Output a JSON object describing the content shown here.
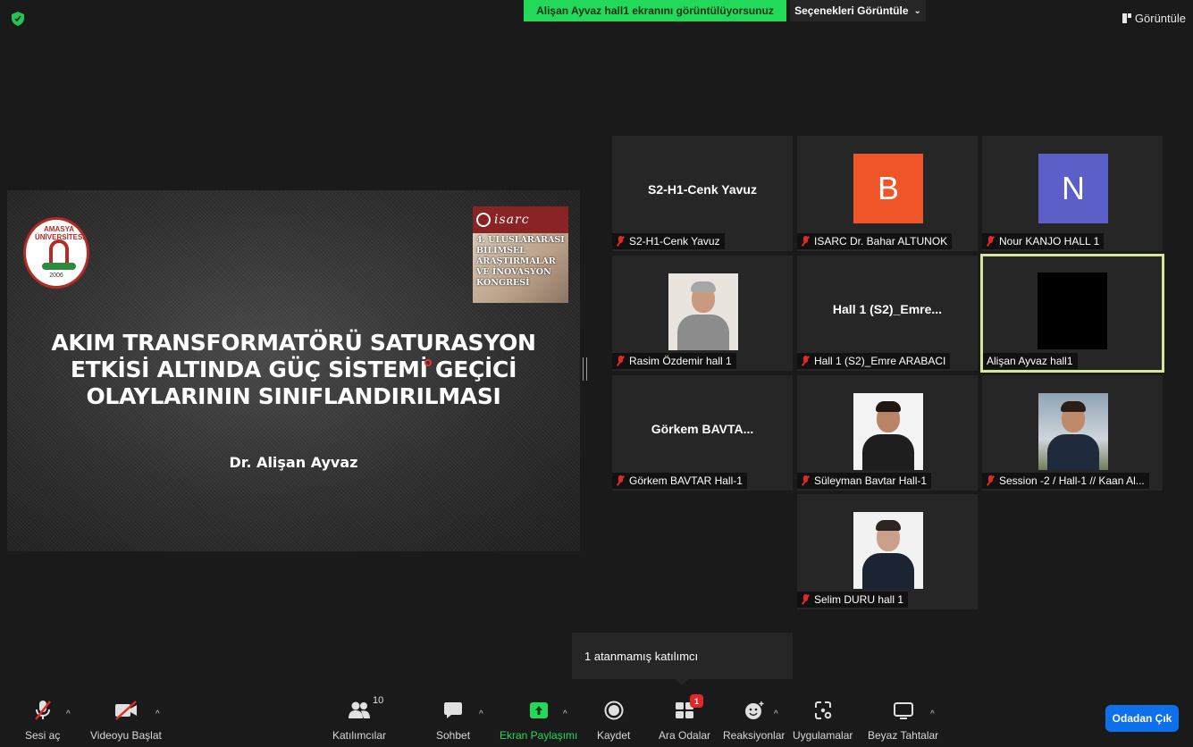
{
  "top_bar": {
    "share_banner": "Alişan Ayvaz hall1 ekranını görüntülüyorsunuz",
    "view_options": "Seçenekleri Görüntüle",
    "view_toggle": "Görüntüle",
    "banner_color": "#23d959"
  },
  "slide": {
    "logo_text": "AMASYA ÜNİVERSİTESİ",
    "logo_year": "2006",
    "isarc_word": "isarc",
    "isarc_lines": [
      "4. ULUSLARARASI",
      "BİLİMSEL",
      "ARAŞTIRMALAR",
      "VE İNOVASYON",
      "KONGRESİ"
    ],
    "title_lines": [
      "AKIM TRANSFORMATÖRÜ SATURASYON",
      "ETKİSİ ALTINDA GÜÇ SİSTEMİ GEÇİCİ",
      "OLAYLARININ SINIFLANDIRILMASI"
    ],
    "author": "Dr. Alişan Ayvaz"
  },
  "gallery": [
    {
      "big_name": "S2-H1-Cenk Yavuz",
      "label": "S2-H1-Cenk Yavuz",
      "muted": true
    },
    {
      "avatar_letter": "B",
      "avatar_color": "#f0552a",
      "label": "ISARC Dr. Bahar ALTUNOK",
      "muted": true
    },
    {
      "avatar_letter": "N",
      "avatar_color": "#5c5fc7",
      "label": "Nour KANJO HALL 1",
      "muted": true
    },
    {
      "photo": true,
      "label": "Rasim Özdemir hall 1",
      "muted": true
    },
    {
      "big_name": "Hall 1 (S2)_Emre...",
      "label": "Hall 1 (S2)_Emre ARABACI",
      "muted": true
    },
    {
      "video_off_black": true,
      "active_speaker": true,
      "label": "Alişan Ayvaz hall1",
      "muted": false
    },
    {
      "big_name": "Görkem  BAVTA...",
      "label": "Görkem BAVTAR Hall-1",
      "muted": true
    },
    {
      "photo": true,
      "label": "Süleyman Bavtar Hall-1",
      "muted": true
    },
    {
      "photo": true,
      "label": "Session -2 / Hall-1 // Kaan Al...",
      "muted": true
    },
    {
      "photo": true,
      "label": "Selim DURU hall 1",
      "muted": true
    }
  ],
  "popup": {
    "text": "1 atanmamış katılımcı"
  },
  "toolbar": {
    "unmute": "Sesi aç",
    "start_video": "Videoyu Başlat",
    "participants": "Katılımcılar",
    "participants_count": "10",
    "chat": "Sohbet",
    "share_screen": "Ekran Paylaşımı",
    "record": "Kaydet",
    "breakout": "Ara Odalar",
    "breakout_badge": "1",
    "reactions": "Reaksiyonlar",
    "apps": "Uygulamalar",
    "whiteboard": "Beyaz Tahtalar",
    "leave": "Odadan Çık",
    "leave_color": "#0e71eb",
    "share_color": "#23d959"
  }
}
